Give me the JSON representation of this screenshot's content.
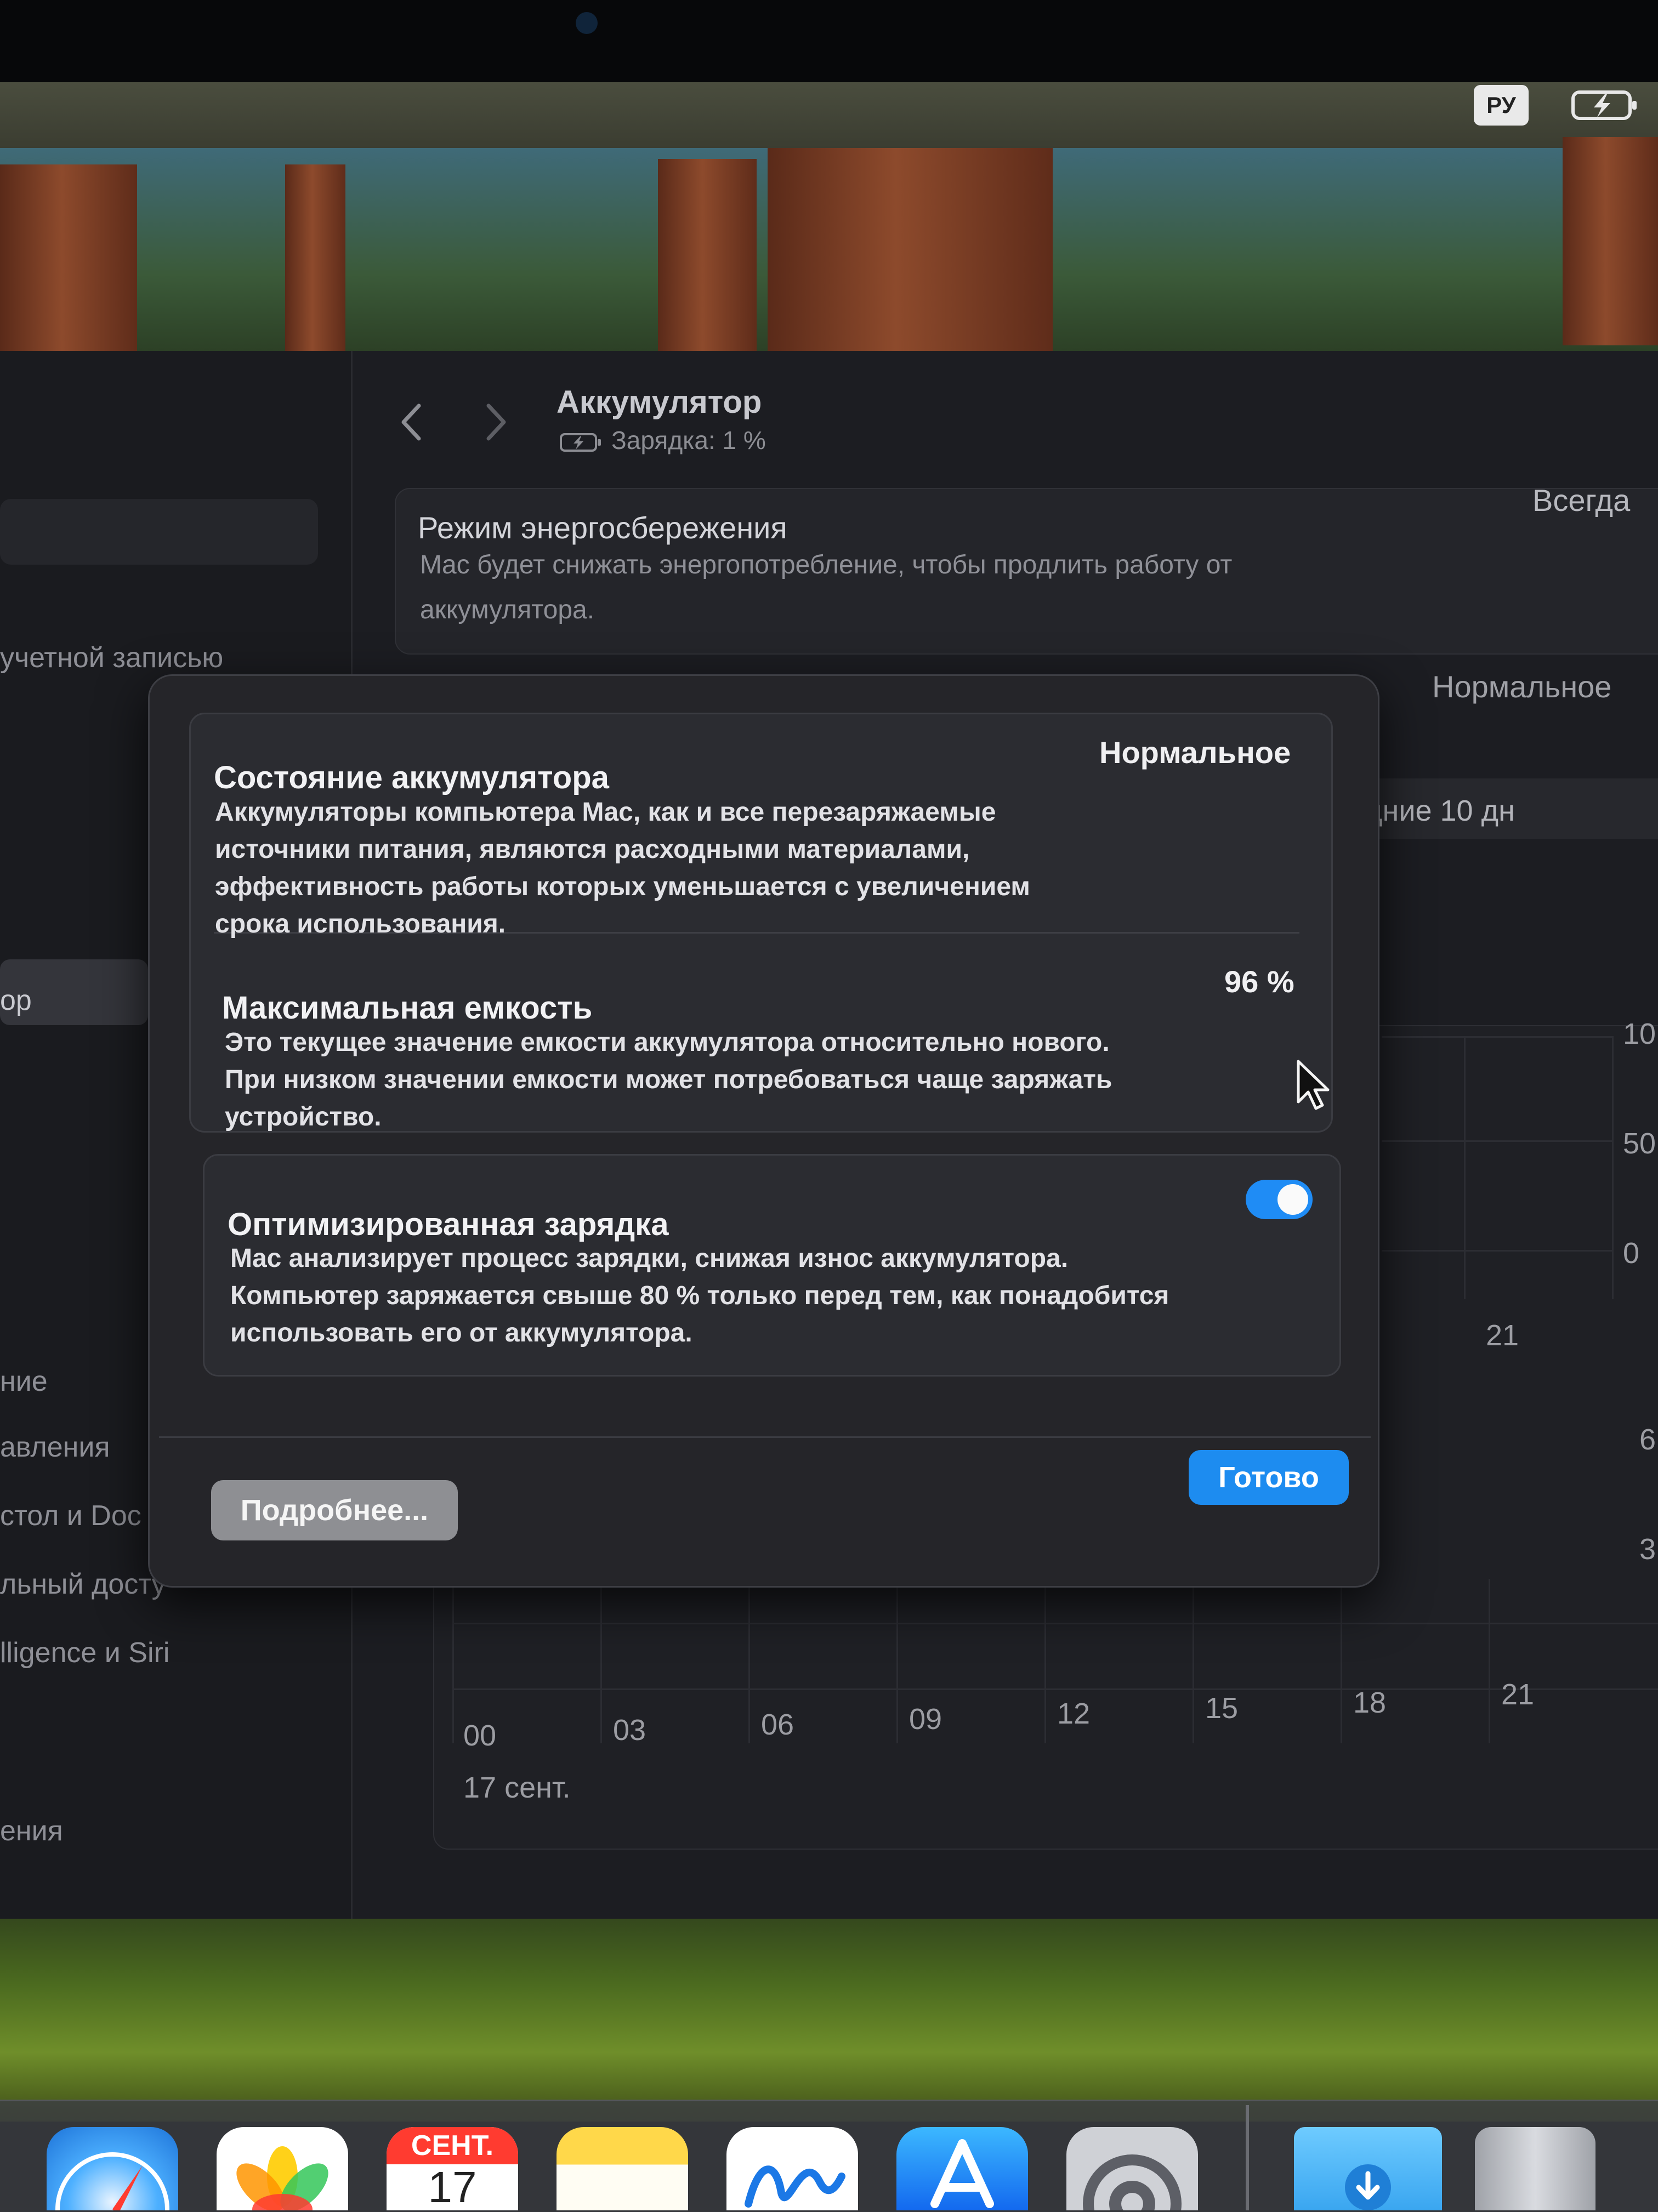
{
  "menubar": {
    "input_language": "РУ",
    "battery_icon": "battery-charging-icon"
  },
  "window": {
    "title": "Аккумулятор",
    "subtitle": "Зарядка: 1 %"
  },
  "sidebar": {
    "items": [
      "учетной записью",
      "ор",
      "ние",
      "авления",
      "стол и Doc",
      "льный досту",
      "lligence и Siri",
      "ения"
    ]
  },
  "low_power": {
    "title": "Режим энергосбережения",
    "description": "Mac будет снижать энергопотребление, чтобы продлить работу от аккумулятора.",
    "value": "Всегда"
  },
  "background": {
    "battery_health_value": "Нормальное",
    "period_label": "дние 10 дн"
  },
  "chart_data": {
    "type": "bar",
    "x_ticks": [
      "00",
      "03",
      "06",
      "09",
      "12",
      "15",
      "18",
      "21"
    ],
    "upper_x_tick": "21",
    "date_label": "17 сент.",
    "right_ticks_top": [
      "10",
      "50",
      "0"
    ],
    "right_ticks_bottom": [
      "6",
      "3"
    ]
  },
  "dialog": {
    "battery_health": {
      "title": "Состояние аккумулятора",
      "description_lines": [
        "Аккумуляторы компьютера Mac, как и все перезаряжаемые",
        "источники питания, являются расходными материалами,",
        "эффективность работы которых уменьшается с увеличением",
        "срока использования."
      ],
      "value": "Нормальное"
    },
    "max_capacity": {
      "title": "Максимальная емкость",
      "description_lines": [
        "Это текущее значение емкости аккумулятора относительно нового.",
        "При низком значении емкости может потребоваться чаще заряжать",
        "устройство."
      ],
      "value": "96 %"
    },
    "optimized_charging": {
      "title": "Оптимизированная зарядка",
      "description_lines": [
        "Mac анализирует процесс зарядки, снижая износ аккумулятора.",
        "Компьютер заряжается свыше 80 % только перед тем, как понадобится",
        "использовать его от аккумулятора."
      ],
      "enabled": true
    },
    "more_button": "Подробнее...",
    "done_button": "Готово"
  },
  "dock": {
    "apps": [
      "Safari",
      "Фото",
      "Календарь",
      "Заметки",
      "Freeform",
      "App Store",
      "Системные настройки",
      "Загрузки",
      "Корзина"
    ],
    "calendar_month": "СЕНТ.",
    "calendar_day": "17"
  },
  "colors": {
    "accent": "#1d8cf0",
    "dialog_bg": "#252529",
    "window_bg": "#1c1d22"
  }
}
